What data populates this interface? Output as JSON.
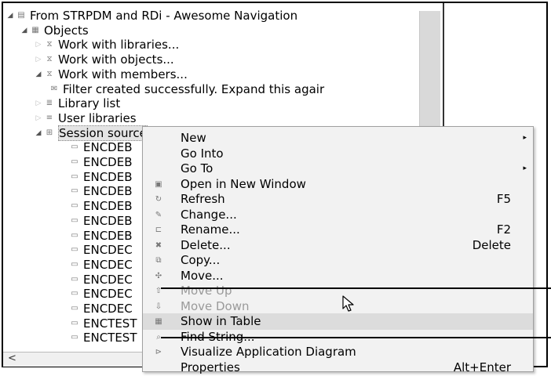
{
  "tree": {
    "rows": [
      {
        "label": "From STRPDM and RDi - Awesome Navigation",
        "expanded": true,
        "icon": "connection-icon"
      },
      {
        "label": "Objects",
        "expanded": true,
        "icon": "filter-pool-icon"
      },
      {
        "label": "Work with libraries...",
        "expanded": false,
        "icon": "filter-icon"
      },
      {
        "label": "Work with objects...",
        "expanded": false,
        "icon": "filter-icon"
      },
      {
        "label": "Work with members...",
        "expanded": true,
        "icon": "filter-icon"
      },
      {
        "label": "Filter created successfully. Expand this agair",
        "expanded": null,
        "icon": "message-icon"
      },
      {
        "label": "Library list",
        "expanded": false,
        "icon": "library-list-icon"
      },
      {
        "label": "User libraries",
        "expanded": false,
        "icon": "user-libraries-icon"
      },
      {
        "label": "Session source",
        "expanded": true,
        "icon": "session-source-icon"
      }
    ],
    "members": [
      "ENCDEB",
      "ENCDEB",
      "ENCDEB",
      "ENCDEB",
      "ENCDEB",
      "ENCDEB",
      "ENCDEB",
      "ENCDEC",
      "ENCDEC",
      "ENCDEC",
      "ENCDEC",
      "ENCDEC",
      "ENCTEST",
      "ENCTEST",
      "ENCTEST",
      "ENCTEST"
    ],
    "scroll_left_glyph": "<"
  },
  "context_menu": {
    "items": [
      {
        "label": "New",
        "shortcut": "",
        "submenu": true,
        "disabled": false,
        "icon": ""
      },
      {
        "label": "Go Into",
        "shortcut": "",
        "submenu": false,
        "disabled": false,
        "icon": ""
      },
      {
        "label": "Go To",
        "shortcut": "",
        "submenu": true,
        "disabled": false,
        "icon": ""
      },
      {
        "label": "Open in New Window",
        "shortcut": "",
        "submenu": false,
        "disabled": false,
        "icon": "window-icon"
      },
      {
        "label": "Refresh",
        "shortcut": "F5",
        "submenu": false,
        "disabled": false,
        "icon": "refresh-icon"
      },
      {
        "label": "Change...",
        "shortcut": "",
        "submenu": false,
        "disabled": false,
        "icon": "change-icon"
      },
      {
        "label": "Rename...",
        "shortcut": "F2",
        "submenu": false,
        "disabled": false,
        "icon": "rename-icon"
      },
      {
        "label": "Delete...",
        "shortcut": "Delete",
        "submenu": false,
        "disabled": false,
        "icon": "delete-icon"
      },
      {
        "label": "Copy...",
        "shortcut": "",
        "submenu": false,
        "disabled": false,
        "icon": "copy-icon"
      },
      {
        "label": "Move...",
        "shortcut": "",
        "submenu": false,
        "disabled": false,
        "icon": "move-icon"
      },
      {
        "label": "Move Up",
        "shortcut": "",
        "submenu": false,
        "disabled": true,
        "icon": "move-up-icon"
      },
      {
        "label": "Move Down",
        "shortcut": "",
        "submenu": false,
        "disabled": true,
        "icon": "move-down-icon"
      },
      {
        "label": "Show in Table",
        "shortcut": "",
        "submenu": false,
        "disabled": false,
        "icon": "table-icon",
        "hover": true
      },
      {
        "label": "Find String...",
        "shortcut": "",
        "submenu": false,
        "disabled": false,
        "icon": "find-icon"
      },
      {
        "label": "Visualize Application Diagram",
        "shortcut": "",
        "submenu": false,
        "disabled": false,
        "icon": "diagram-icon"
      },
      {
        "label": "Properties",
        "shortcut": "Alt+Enter",
        "submenu": false,
        "disabled": false,
        "icon": ""
      }
    ],
    "submenu_glyph": "▸"
  },
  "icon_glyphs": {
    "connection-icon": "▤",
    "filter-pool-icon": "▦",
    "filter-icon": "⧖",
    "message-icon": "✉",
    "library-list-icon": "≣",
    "user-libraries-icon": "≡",
    "session-source-icon": "⊞",
    "member-icon": "▭",
    "window-icon": "▣",
    "refresh-icon": "↻",
    "change-icon": "✎",
    "rename-icon": "⊏",
    "delete-icon": "✖",
    "copy-icon": "⧉",
    "move-icon": "✣",
    "move-up-icon": "⇧",
    "move-down-icon": "⇩",
    "table-icon": "▦",
    "find-icon": "⌕",
    "diagram-icon": "⊳"
  }
}
